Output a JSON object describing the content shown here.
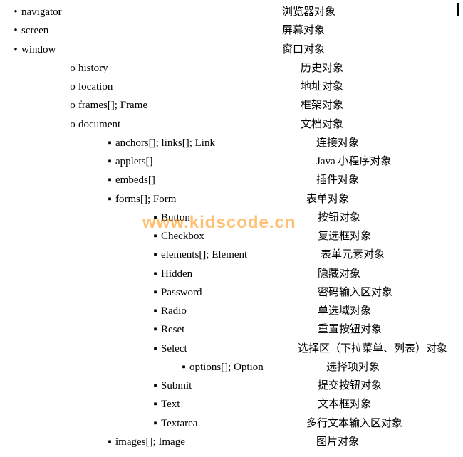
{
  "watermark": "www.kidscode.cn",
  "glyphs": {
    "disc": "•",
    "circle": "o",
    "square": "▪"
  },
  "col2_default": 396,
  "rows": [
    {
      "indent": 0,
      "bullet": "disc",
      "left": "navigator",
      "right": "浏览器对象"
    },
    {
      "indent": 0,
      "bullet": "disc",
      "left": "screen",
      "right": "屏幕对象"
    },
    {
      "indent": 0,
      "bullet": "disc",
      "left": "window",
      "right": "窗口对象"
    },
    {
      "indent": 1,
      "bullet": "circle",
      "left": "history",
      "right": "历史对象",
      "col2": 422
    },
    {
      "indent": 1,
      "bullet": "circle",
      "left": "location",
      "right": "地址对象",
      "col2": 422
    },
    {
      "indent": 1,
      "bullet": "circle",
      "left": "frames[]; Frame",
      "right": "框架对象",
      "col2": 422
    },
    {
      "indent": 1,
      "bullet": "circle",
      "left": "document",
      "right": "文档对象",
      "col2": 422
    },
    {
      "indent": 2,
      "bullet": "square",
      "left": "anchors[]; links[]; Link",
      "right": "连接对象",
      "col2": 444
    },
    {
      "indent": 2,
      "bullet": "square",
      "left": "applets[]",
      "right": "Java 小程序对象",
      "col2": 444
    },
    {
      "indent": 2,
      "bullet": "square",
      "left": "embeds[]",
      "right": "插件对象",
      "col2": 444
    },
    {
      "indent": 2,
      "bullet": "square",
      "left": "forms[]; Form",
      "right": "表单对象",
      "col2": 430
    },
    {
      "indent": 3,
      "bullet": "square",
      "left": "Button",
      "right": "按钮对象",
      "col2": 446
    },
    {
      "indent": 3,
      "bullet": "square",
      "left": "Checkbox",
      "right": "复选框对象",
      "col2": 446
    },
    {
      "indent": 3,
      "bullet": "square",
      "left": "elements[]; Element",
      "right": "表单元素对象",
      "col2": 450
    },
    {
      "indent": 3,
      "bullet": "square",
      "left": "Hidden",
      "right": "隐藏对象",
      "col2": 446
    },
    {
      "indent": 3,
      "bullet": "square",
      "left": "Password",
      "right": "密码输入区对象",
      "col2": 446
    },
    {
      "indent": 3,
      "bullet": "square",
      "left": "Radio",
      "right": "单选域对象",
      "col2": 446
    },
    {
      "indent": 3,
      "bullet": "square",
      "left": "Reset",
      "right": "重置按钮对象",
      "col2": 446
    },
    {
      "indent": 3,
      "bullet": "square",
      "left": "Select",
      "right": "选择区（下拉菜单、列表）对象",
      "col2": 418
    },
    {
      "indent": 4,
      "bullet": "square",
      "left": "options[]; Option",
      "right": "选择项对象",
      "col2": 458
    },
    {
      "indent": 3,
      "bullet": "square",
      "left": "Submit",
      "right": "提交按钮对象",
      "col2": 446
    },
    {
      "indent": 3,
      "bullet": "square",
      "left": "Text",
      "right": "文本框对象",
      "col2": 446
    },
    {
      "indent": 3,
      "bullet": "square",
      "left": "Textarea",
      "right": "多行文本输入区对象",
      "col2": 430
    },
    {
      "indent": 2,
      "bullet": "square",
      "left": "images[]; Image",
      "right": "图片对象",
      "col2": 444
    }
  ]
}
